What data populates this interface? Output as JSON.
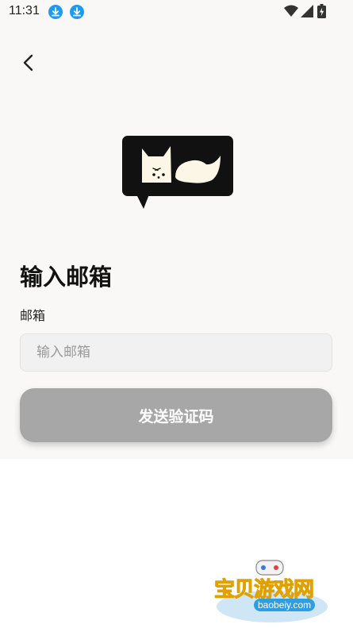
{
  "status_bar": {
    "time": "11:31"
  },
  "icons": {
    "back": "chevron-left-icon",
    "download": "download-icon",
    "wifi": "wifi-icon",
    "signal": "signal-icon",
    "battery": "battery-charging-icon"
  },
  "page": {
    "title": "输入邮箱",
    "email_label": "邮箱",
    "email_placeholder": "输入邮箱",
    "email_value": "",
    "send_button_label": "发送验证码"
  },
  "watermark": {
    "text": "宝贝游戏网",
    "url": "baobeiy.com"
  },
  "colors": {
    "app_background": "#f9f8f6",
    "button_disabled": "#a7a7a7",
    "input_background": "#f1f1f1",
    "logo_black": "#111111",
    "logo_cream": "#fbf6e6",
    "download_blue": "#1e9bf0"
  }
}
